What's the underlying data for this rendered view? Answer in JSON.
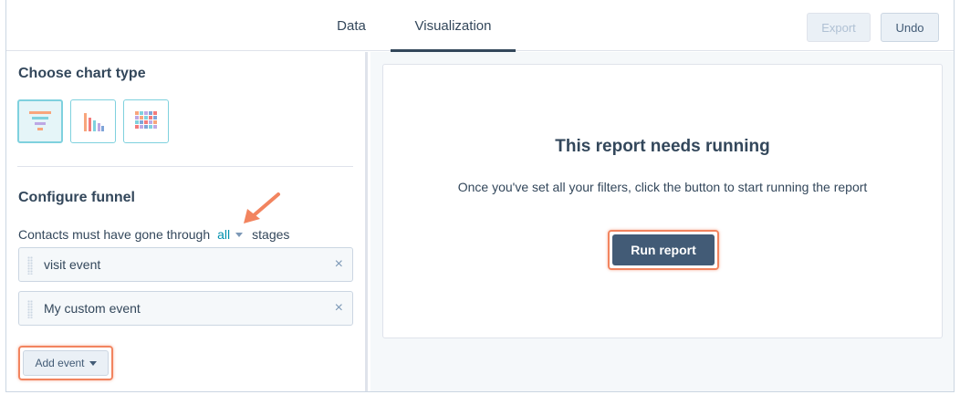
{
  "tabs": [
    {
      "label": "Data",
      "active": false
    },
    {
      "label": "Visualization",
      "active": true
    }
  ],
  "header": {
    "export_label": "Export",
    "export_enabled": false,
    "undo_label": "Undo"
  },
  "left_panel": {
    "chart_type_title": "Choose chart type",
    "chart_types": [
      {
        "icon": "funnel-chart-icon",
        "selected": true
      },
      {
        "icon": "bar-chart-icon",
        "selected": false
      },
      {
        "icon": "grid-chart-icon",
        "selected": false
      }
    ],
    "funnel_title": "Configure funnel",
    "funnel_sentence": {
      "prefix": "Contacts must have gone through",
      "selector_value": "all",
      "suffix": "stages"
    },
    "events": [
      {
        "label": "visit event"
      },
      {
        "label": "My custom event"
      }
    ],
    "add_event_label": "Add event"
  },
  "report_card": {
    "title": "This report needs running",
    "description": "Once you've set all your filters, click the button to start running the report",
    "run_label": "Run report"
  },
  "colors": {
    "text": "#33475b",
    "link": "#0091ae",
    "highlight": "#f2845f",
    "primary_button": "#425b76",
    "accent_teal": "#7fd1de"
  }
}
